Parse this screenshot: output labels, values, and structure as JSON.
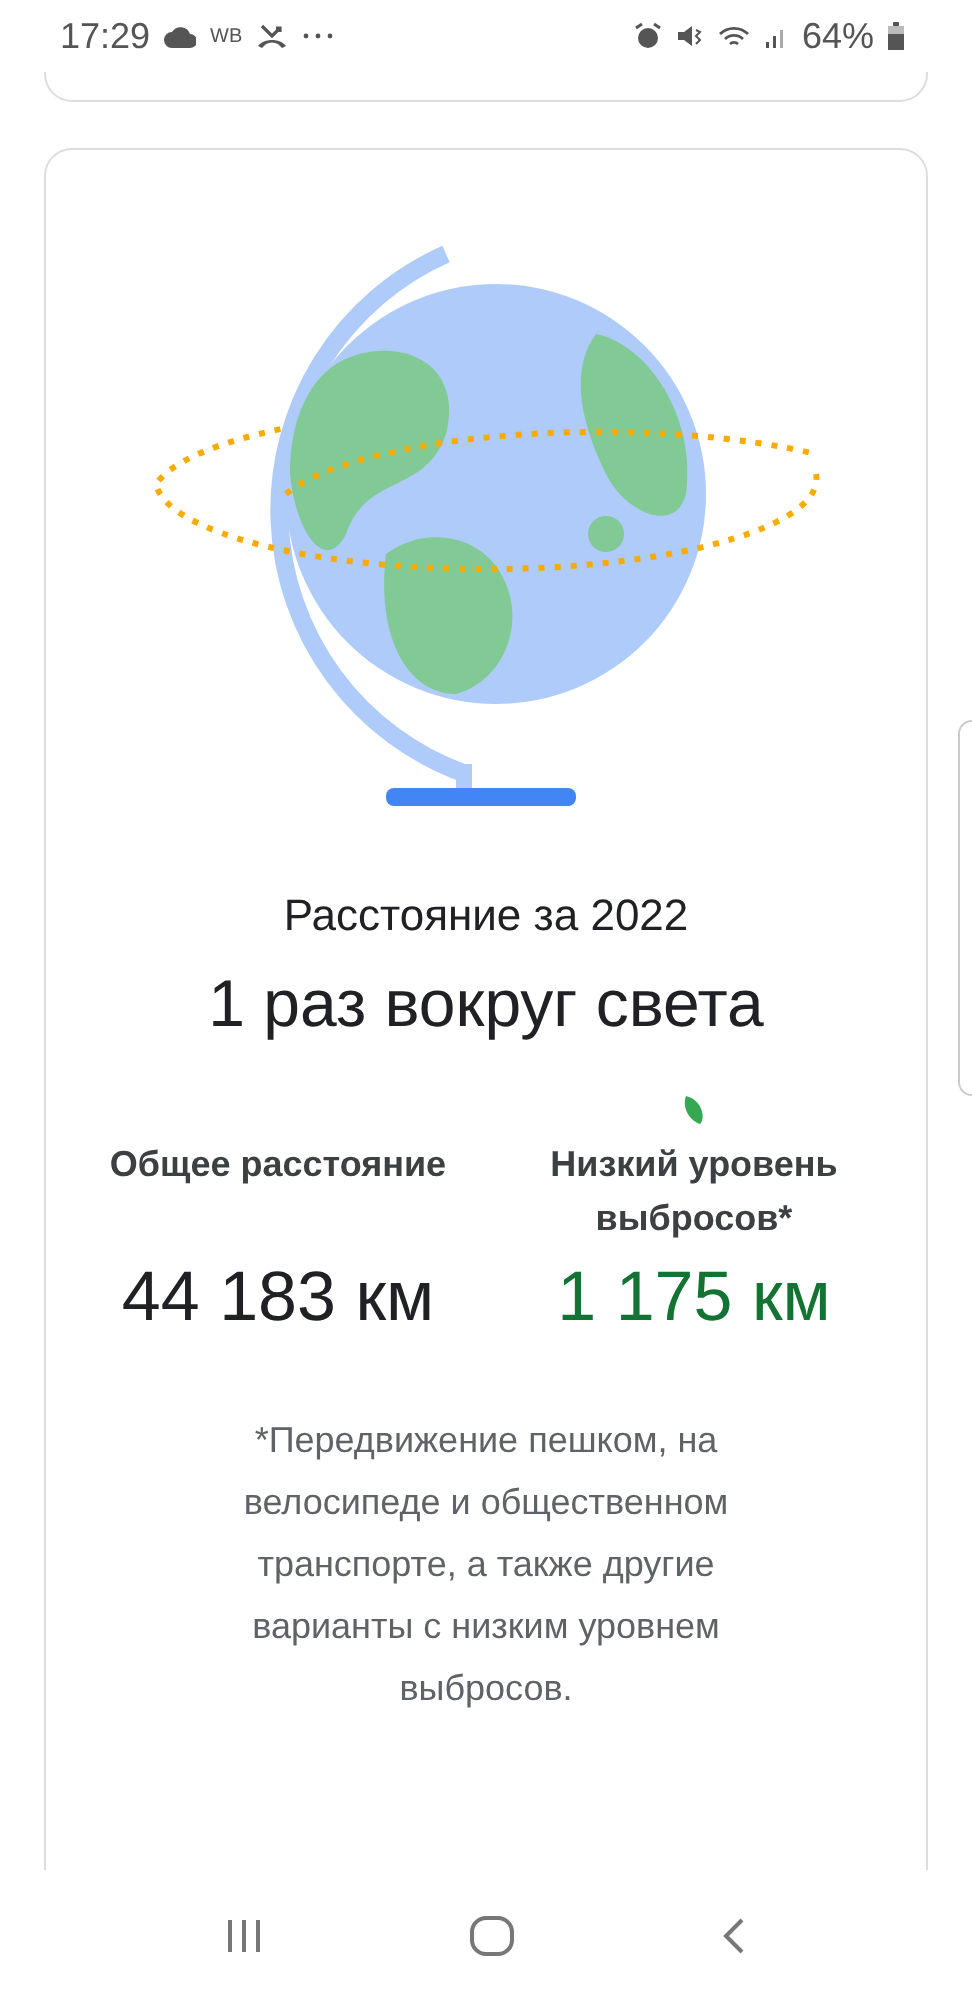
{
  "status_bar": {
    "time": "17:29",
    "carrier": "WB",
    "battery": "64%"
  },
  "card": {
    "title": "Расстояние за 2022",
    "headline": "1 раз вокруг света",
    "stats": [
      {
        "kind": "total",
        "label": "Общее расстояние",
        "value": "44 183 км"
      },
      {
        "kind": "low_emission",
        "label": "Низкий уровень выбросов*",
        "value": "1 175 км"
      }
    ],
    "footnote": "*Передвижение пешком, на велосипеде и общественном транспорте, а также другие варианты с низким уровнем выбросов."
  }
}
